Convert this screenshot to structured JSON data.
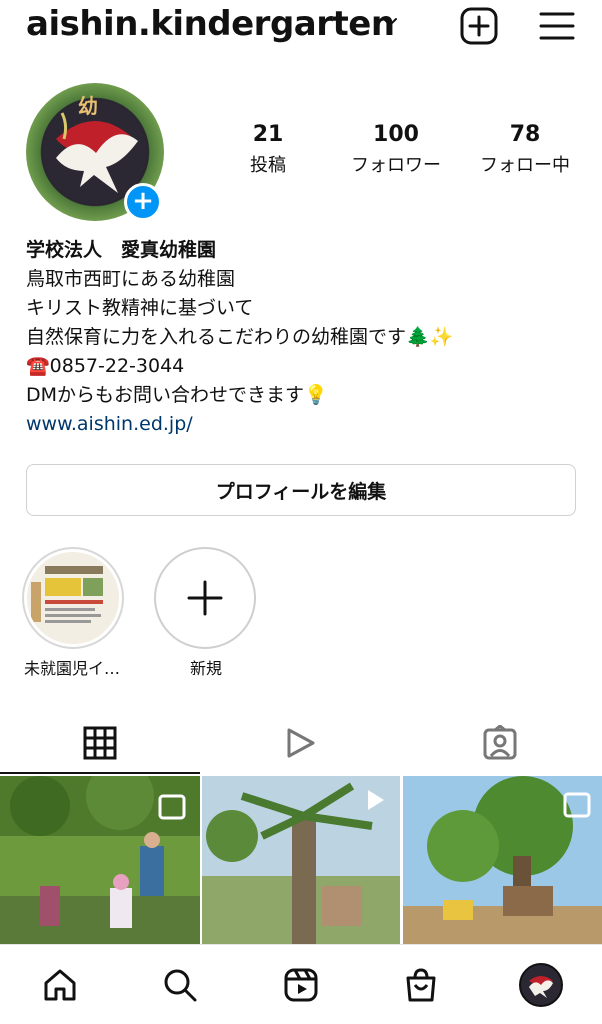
{
  "header": {
    "username": "aishin.kindergarten",
    "icons": [
      "chevron-down-icon",
      "new-post-icon",
      "menu-icon"
    ]
  },
  "profile": {
    "avatar_icon": "dove-logo",
    "stats": [
      {
        "value": "21",
        "label": "投稿"
      },
      {
        "value": "100",
        "label": "フォロワー"
      },
      {
        "value": "78",
        "label": "フォロー中"
      }
    ]
  },
  "bio": {
    "name": "学校法人　愛真幼稚園",
    "line1": "鳥取市西町にある幼稚園",
    "line2": "キリスト教精神に基づいて",
    "line3": "自然保育に力を入れるこだわりの幼稚園です🌲✨",
    "line4": "☎️0857-22-3044",
    "line5": "DMからもお問い合わせできます💡",
    "link": "www.aishin.ed.jp/"
  },
  "edit_button": "プロフィールを編集",
  "highlights": [
    {
      "label": "未就園児イ…"
    },
    {
      "label": "新規"
    }
  ],
  "tabs": [
    "grid-icon",
    "reels-icon",
    "tagged-icon"
  ],
  "bottom_nav": [
    "home-icon",
    "search-icon",
    "reels-icon",
    "shop-icon",
    "profile-avatar"
  ],
  "colors": {
    "accent": "#0095f6",
    "link": "#00376b"
  }
}
